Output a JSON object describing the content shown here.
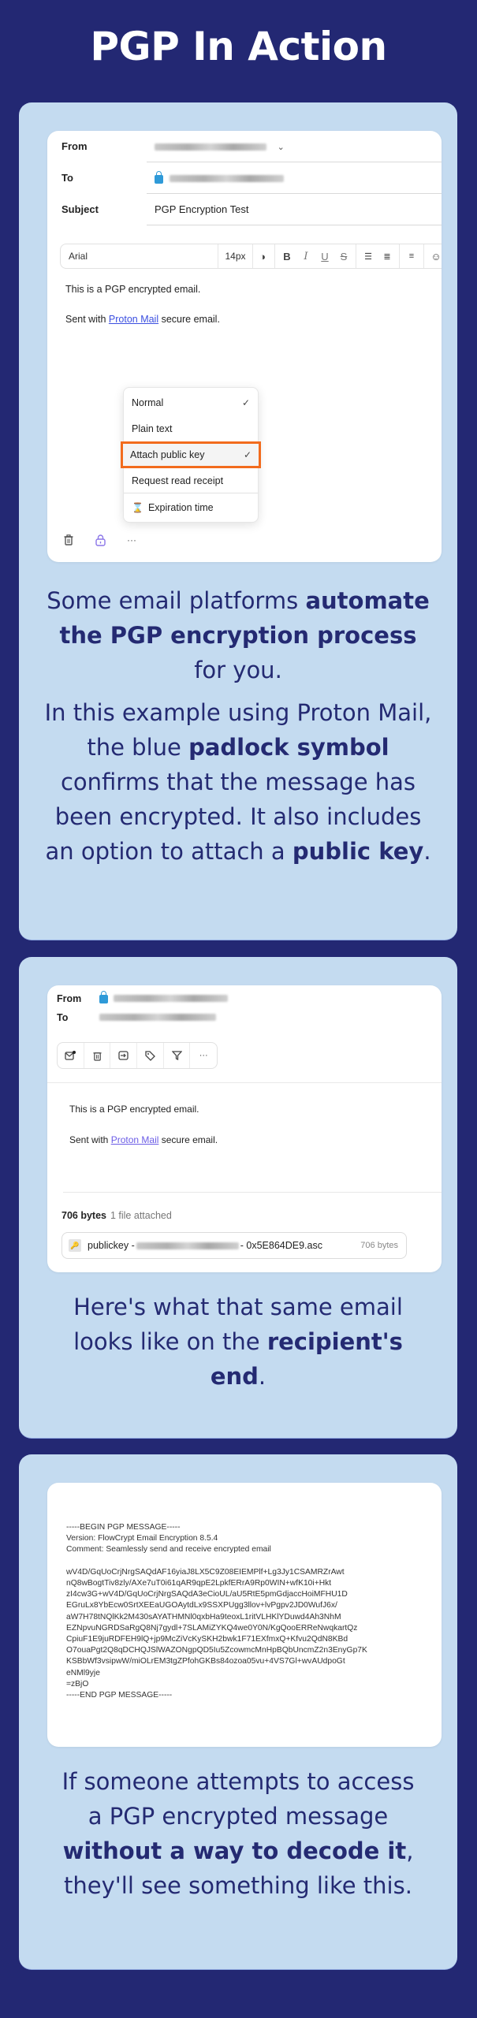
{
  "title": "PGP In Action",
  "colors": {
    "page_bg": "#232873",
    "panel_bg": "#c4dbf0",
    "caption_text": "#242a72",
    "highlight_outline": "#f26b1d",
    "padlock_blue": "#2f9ad8",
    "link_blue": "#3b4fe0"
  },
  "compose": {
    "fields": [
      {
        "label": "From",
        "value_blurred": true
      },
      {
        "label": "To",
        "value_blurred": true,
        "icon": "padlock-icon"
      },
      {
        "label": "Subject",
        "value": "PGP Encryption Test"
      }
    ],
    "toolbar": {
      "font": "Arial",
      "size": "14px",
      "buttons": [
        "contrast-icon",
        "bold-icon",
        "italic-icon",
        "underline-icon",
        "strikethrough-icon",
        "bullet-list-icon",
        "numbered-list-icon",
        "align-left-icon",
        "emoji-icon"
      ]
    },
    "body": {
      "line1": "This is a PGP encrypted email.",
      "line2_prefix": "Sent with ",
      "line2_link": "Proton Mail",
      "line2_suffix": " secure email."
    },
    "menu": {
      "items": [
        {
          "label": "Normal",
          "checked": true
        },
        {
          "label": "Plain text",
          "checked": false
        },
        {
          "label": "Attach public key",
          "checked": true,
          "highlighted": true
        },
        {
          "label": "Request read receipt",
          "checked": false
        },
        {
          "label": "Expiration time",
          "icon": "hourglass-icon"
        }
      ]
    },
    "bottom_icons": [
      "trash-icon",
      "padlock-icon",
      "more-icon"
    ],
    "check_glyph": "✓",
    "more_glyph": "···"
  },
  "caption1": {
    "p1_a": "Some email platforms ",
    "p1_b": "automate the PGP encryption process",
    "p1_c": " for you.",
    "p2_a": "In this example using Proton Mail, the blue ",
    "p2_b": "padlock symbol",
    "p2_c": " confirms that the message has been encrypted. It also includes an option to attach a ",
    "p2_d": "public key",
    "p2_e": "."
  },
  "received": {
    "from_label": "From",
    "to_label": "To",
    "actions": [
      "mark-unread-icon",
      "trash-icon",
      "move-icon",
      "label-icon",
      "filter-icon",
      "more-icon"
    ],
    "body": {
      "line1": "This is a PGP encrypted email.",
      "line2_prefix": "Sent with ",
      "line2_link": "Proton Mail",
      "line2_suffix": " secure email."
    },
    "attachments": {
      "total_size": "706 bytes",
      "count_text": "1 file attached",
      "file_prefix": "publickey - ",
      "file_suffix": " - 0x5E864DE9.asc",
      "file_size": "706 bytes"
    }
  },
  "caption2": {
    "a": "Here's what that same email looks like on the ",
    "b": "recipient's end",
    "c": "."
  },
  "pgp_message": {
    "lines": [
      "-----BEGIN PGP MESSAGE-----",
      "Version: FlowCrypt Email Encryption 8.5.4",
      "Comment: Seamlessly send and receive encrypted email",
      "",
      "wV4D/GqUoCrjNrgSAQdAF16yiaJ8LX5C9Z08EIEMPlf+Lg3Jy1CSAMRZrAwt",
      "nQ8wBogtTiv8zly/AXe7uT0i61qAR9qpE2LpkfERrA9Rp0WIN+wfK10i+Hkt",
      "zI4cw3G+wV4D/GqUoCrjNrgSAQdA3eCioUL/aU5RtE5pmGdjaccHoiMFHU1D",
      "EGruLx8YbEcw0SrtXEEaUGOAytdLx9SSXPUgg3llov+lvPgpv2JD0WufJ6x/",
      "aW7H78tNQlKk2M430sAYATHMNl0qxbHa9teoxL1ritVLHKlYDuwd4Ah3NhM",
      "EZNpvuNGRDSaRgQ8Nj7gydl+7SLAMiZYKQ4we0Y0N/KgQooERReNwqkartQz",
      "CpiuF1E9juRDFEH9lQ+jp9McZiVcKySKH2bwk1F71EXfmxQ+Kfvu2QdN8KBd",
      "O7ouaPgt2Q8qDCHQJSlWAZONgpQD5Iu5ZcowmcMnHpBQbUncmZ2n3EnyGp7K",
      "KSBbWf3vsipwW/miOLrEM3tgZPfohGKBs84ozoa05vu+4VS7Gl+wvAUdpoGt",
      "eNMl9yje",
      "=zBjO",
      "-----END PGP MESSAGE-----"
    ]
  },
  "caption3": {
    "a": "If someone attempts to access a PGP encrypted message ",
    "b": "without a way to decode it",
    "c": ", they'll see something like this."
  }
}
